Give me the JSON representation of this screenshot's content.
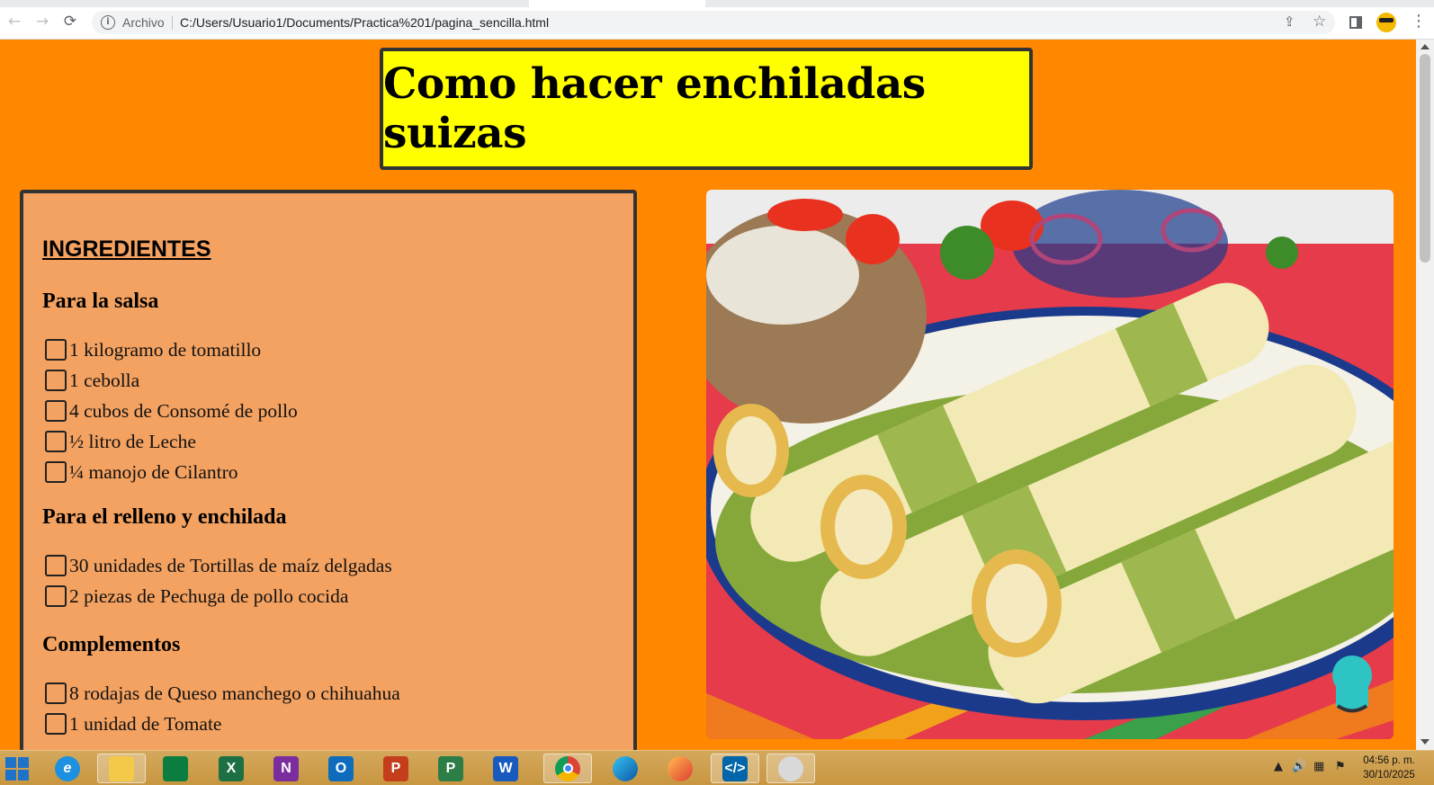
{
  "browser": {
    "back_icon": "←",
    "forward_icon": "→",
    "reload_icon": "⟳",
    "protocol_label": "Archivo",
    "url": "C:/Users/Usuario1/Documents/Practica%201/pagina_sencilla.html",
    "share_icon": "⇪",
    "star_icon": "☆",
    "menu_icon": "⋮"
  },
  "page": {
    "title": "Como hacer enchiladas suizas",
    "ingredients_heading": "INGREDIENTES",
    "sections": [
      {
        "heading": "Para la salsa",
        "items": [
          "1 kilogramo de tomatillo",
          "1 cebolla",
          "4 cubos de Consomé de pollo",
          "½ litro de Leche",
          "¼ manojo de Cilantro"
        ]
      },
      {
        "heading": "Para el relleno y enchilada",
        "items": [
          "30 unidades de Tortillas de maíz delgadas",
          "2 piezas de Pechuga de pollo cocida"
        ]
      },
      {
        "heading": "Complementos",
        "items": [
          "8 rodajas de Queso manchego o chihuahua",
          "1 unidad de Tomate"
        ]
      }
    ],
    "colors": {
      "page_background": "#ff8800",
      "title_background": "#ffff00",
      "ingredients_background": "#f4a261",
      "border": "#333333"
    }
  },
  "taskbar": {
    "apps": [
      "start",
      "internet-explorer",
      "file-explorer",
      "microsoft-store",
      "excel",
      "onenote",
      "outlook",
      "powerpoint",
      "project",
      "word",
      "chrome",
      "edge",
      "firefox",
      "vscode",
      "paint"
    ],
    "clock_time": "04:56 p. m.",
    "clock_date": "30/10/2025"
  }
}
